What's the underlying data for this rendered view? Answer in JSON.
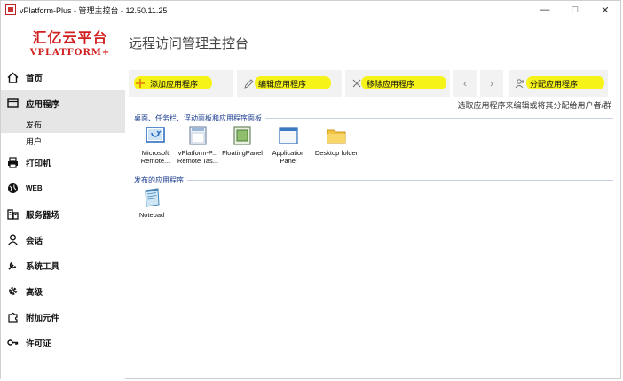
{
  "window": {
    "title": "vPlatform-Plus - 管理主控台 - 12.50.11.25"
  },
  "header": {
    "logo_cn": "汇亿云平台",
    "logo_en": "VPLATFORM+",
    "page_title": "远程访问管理主控台"
  },
  "sidebar": {
    "items": [
      {
        "label": "首页",
        "icon": "home-icon"
      },
      {
        "label": "应用程序",
        "icon": "window-icon",
        "active": true
      },
      {
        "label": "发布",
        "sub": true,
        "active": true
      },
      {
        "label": "用户",
        "sub": true
      },
      {
        "label": "打印机",
        "icon": "printer-icon"
      },
      {
        "label": "WEB",
        "icon": "globe-icon"
      },
      {
        "label": "服务器场",
        "icon": "server-farm-icon"
      },
      {
        "label": "会话",
        "icon": "user-icon"
      },
      {
        "label": "系统工具",
        "icon": "wrench-icon"
      },
      {
        "label": "高级",
        "icon": "gear-icon"
      },
      {
        "label": "附加元件",
        "icon": "puzzle-icon"
      },
      {
        "label": "许可证",
        "icon": "key-icon"
      }
    ]
  },
  "toolbar": {
    "add": "添加应用程序",
    "edit": "编辑应用程序",
    "remove": "移除应用程序",
    "prev": "‹",
    "next": "›",
    "assign": "分配应用程序"
  },
  "hint": "选取应用程序来编辑或将其分配给用户者/群",
  "groups": [
    {
      "title": "桌面、任务栏、浮动面板和应用程序面板",
      "apps": [
        {
          "label": "Microsoft Remote...",
          "icon": "remote-desktop-icon"
        },
        {
          "label": "vPlatform-P... Remote Tas...",
          "icon": "taskbar-icon"
        },
        {
          "label": "FloatingPanel",
          "icon": "floating-panel-icon"
        },
        {
          "label": "Application Panel",
          "icon": "application-panel-icon"
        },
        {
          "label": "Desktop folder",
          "icon": "folder-icon"
        }
      ]
    },
    {
      "title": "发布的应用程序",
      "apps": [
        {
          "label": "Notepad",
          "icon": "notepad-icon"
        }
      ]
    }
  ],
  "colors": {
    "brand": "#d0201f",
    "highlight": "#f5f20c",
    "active_bg": "#e6e6e6",
    "group_title": "#1a3d8f"
  }
}
